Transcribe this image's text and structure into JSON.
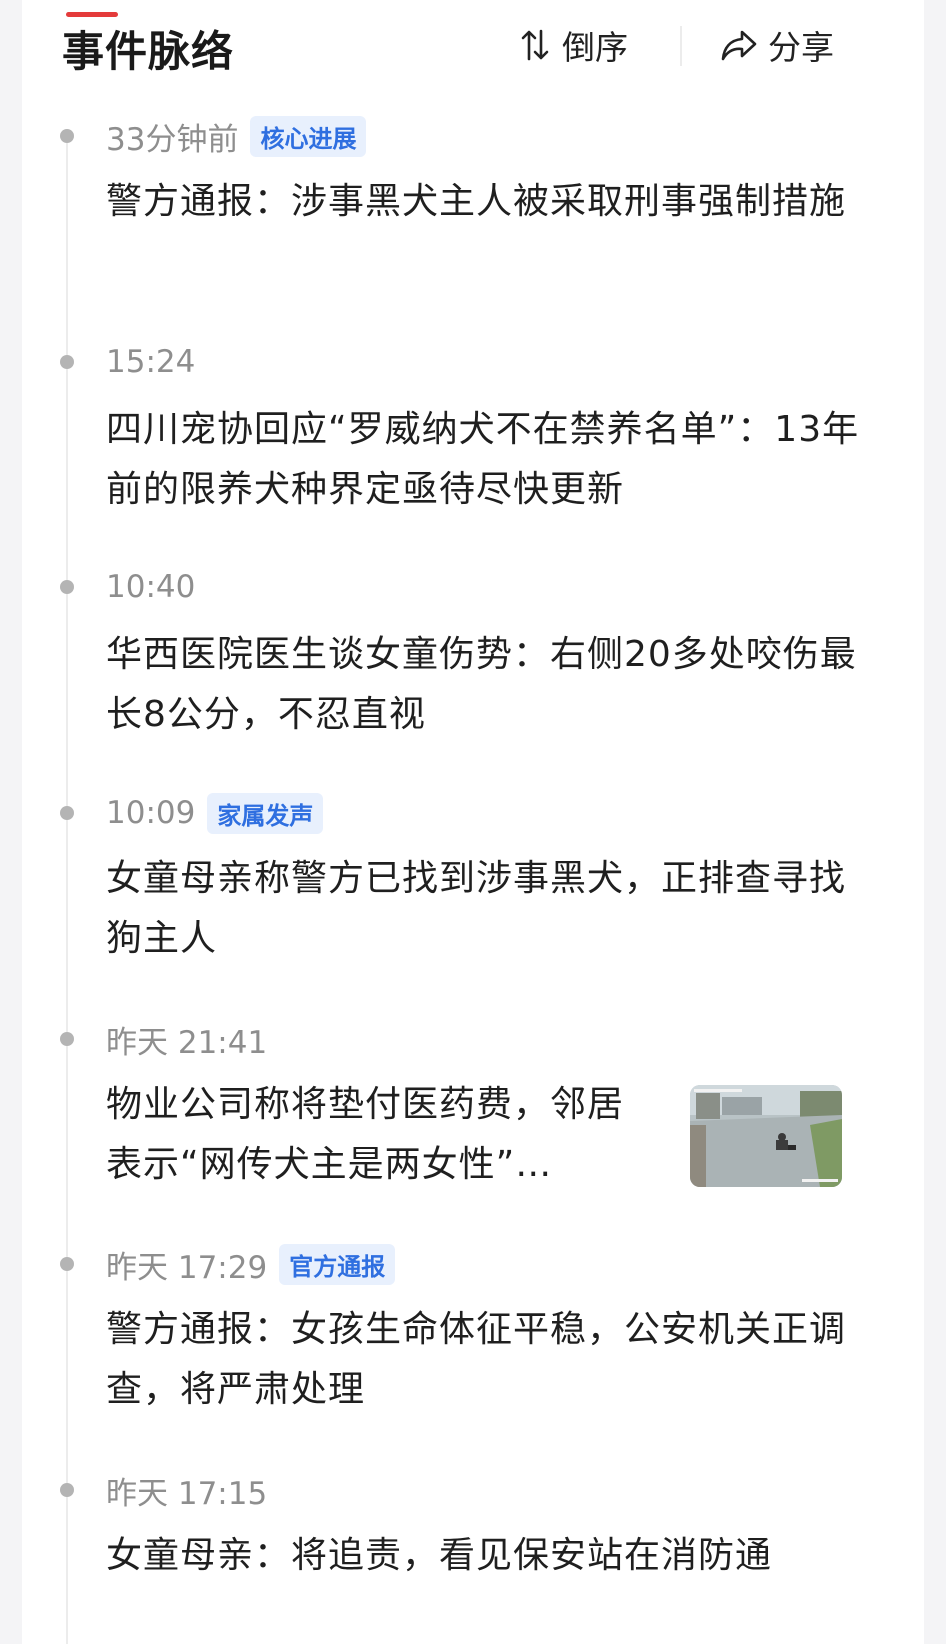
{
  "header": {
    "title": "事件脉络",
    "sort_label": "倒序",
    "share_label": "分享",
    "sort_icon": "sort-arrows-icon",
    "share_icon": "share-arrow-icon"
  },
  "colors": {
    "accent": "#e43b3b",
    "tag_bg": "#e8f0fd",
    "tag_text": "#2f6fe0",
    "timestamp": "#8e8e8e"
  },
  "events": [
    {
      "time": "33分钟前",
      "tag": "核心进展",
      "headline": "警方通报：涉事黑犬主人被采取刑事强制措施"
    },
    {
      "time": "15:24",
      "headline": "四川宠协回应“罗威纳犬不在禁养名单”：13年前的限养犬种界定亟待尽快更新"
    },
    {
      "time": "10:40",
      "headline": "华西医院医生谈女童伤势：右侧20多处咬伤最长8公分，不忍直视"
    },
    {
      "time": "10:09",
      "tag": "家属发声",
      "headline": "女童母亲称警方已找到涉事黑犬，正排查寻找狗主人"
    },
    {
      "time": "昨天 21:41",
      "headline": "物业公司称将垫付医药费，邻居表示“网传犬主是两女性”…",
      "has_thumbnail": true
    },
    {
      "time": "昨天 17:29",
      "tag": "官方通报",
      "headline": "警方通报：女孩生命体征平稳，公安机关正调查，将严肃处理"
    },
    {
      "time": "昨天 17:15",
      "headline": "女童母亲：将追责，看见保安站在消防通"
    }
  ]
}
